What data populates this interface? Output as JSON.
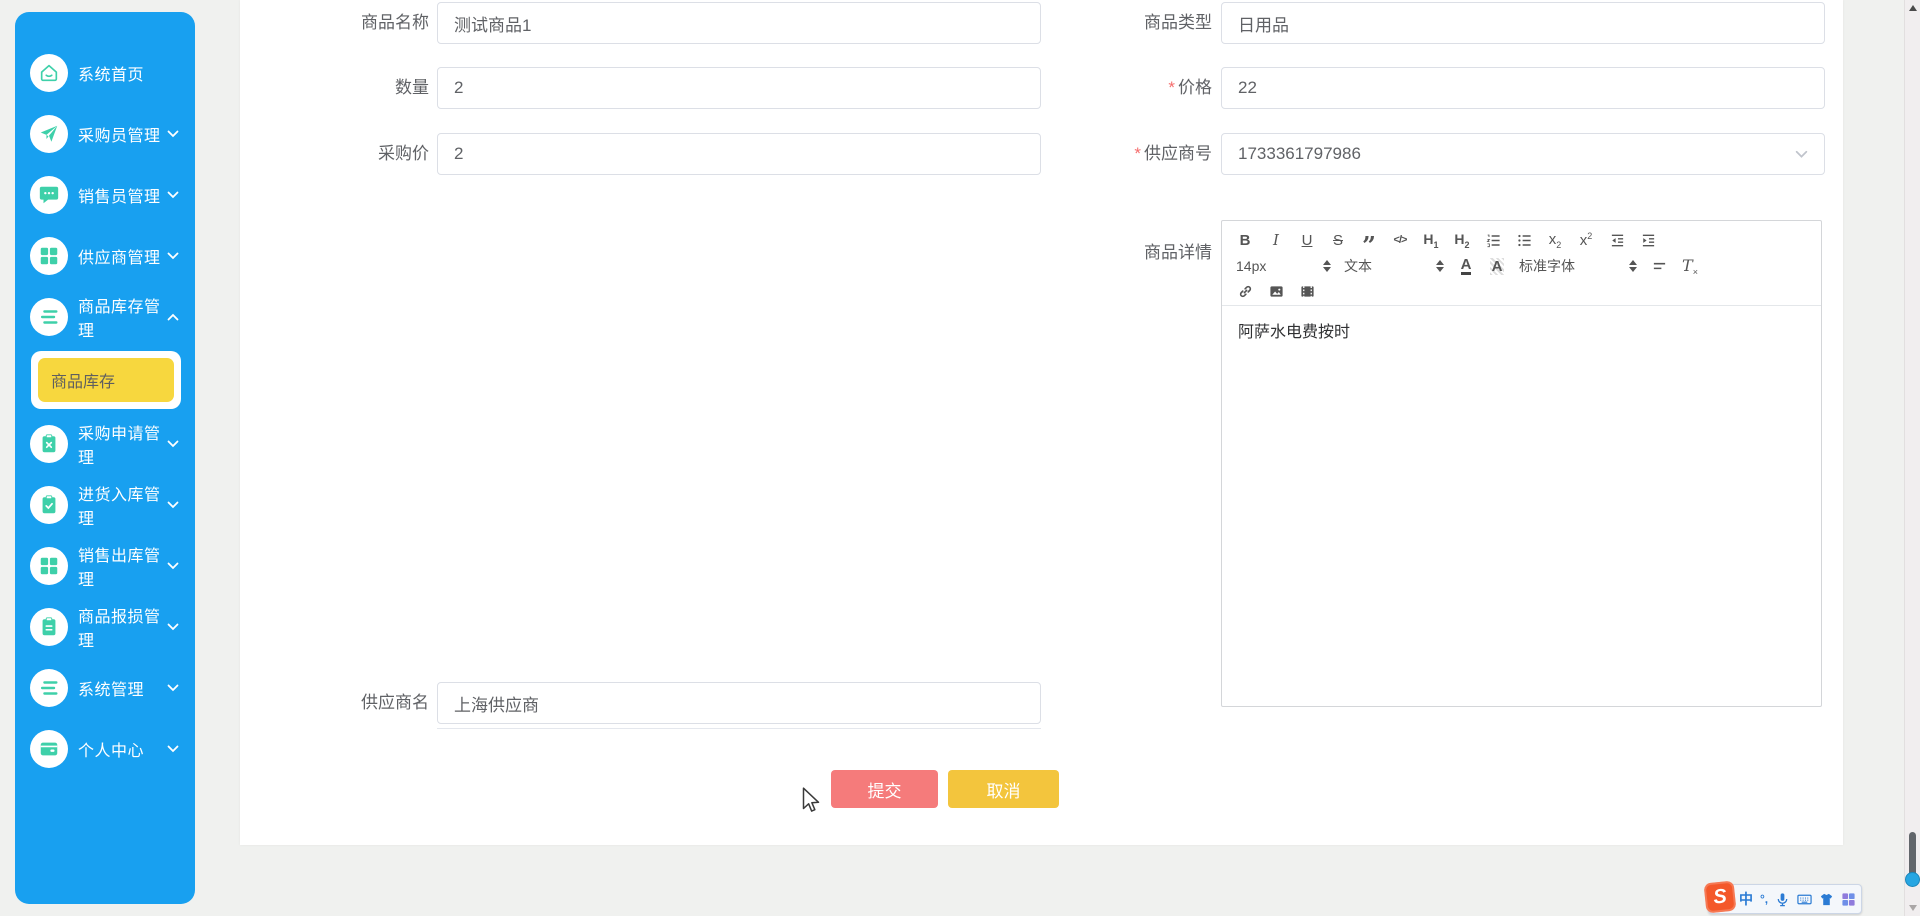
{
  "colors": {
    "sidebar_blue": "#18a0f0",
    "accent_teal": "#3ed0a9",
    "active_yellow": "#f7d73e",
    "submit_red": "#f57b7b",
    "cancel_yellow": "#f3c53d",
    "required_red": "#f56c6c"
  },
  "sidebar": {
    "items": [
      {
        "key": "home",
        "label": "系统首页",
        "icon": "home-icon",
        "chevron": null
      },
      {
        "key": "purchaser",
        "label": "采购员管理",
        "icon": "paper-plane-icon",
        "chevron": "down"
      },
      {
        "key": "salesperson",
        "label": "销售员管理",
        "icon": "chat-icon",
        "chevron": "down"
      },
      {
        "key": "supplier",
        "label": "供应商管理",
        "icon": "grid-icon",
        "chevron": "down"
      },
      {
        "key": "inventory",
        "label": "商品库存管理",
        "icon": "list-icon",
        "chevron": "up",
        "children": [
          {
            "key": "inventory-list",
            "label": "商品库存",
            "active": true
          }
        ]
      },
      {
        "key": "purchase-request",
        "label": "采购申请管理",
        "icon": "clipboard-x-icon",
        "chevron": "down"
      },
      {
        "key": "stock-in",
        "label": "进货入库管理",
        "icon": "clipboard-check-icon",
        "chevron": "down"
      },
      {
        "key": "stock-out",
        "label": "销售出库管理",
        "icon": "grid-icon",
        "chevron": "down"
      },
      {
        "key": "damage",
        "label": "商品报损管理",
        "icon": "clipboard-icon",
        "chevron": "down"
      },
      {
        "key": "system",
        "label": "系统管理",
        "icon": "list-icon",
        "chevron": "down"
      },
      {
        "key": "profile",
        "label": "个人中心",
        "icon": "wallet-icon",
        "chevron": "down"
      }
    ]
  },
  "form": {
    "required_marker": "*",
    "product_name": {
      "label": "商品名称",
      "value": "测试商品1"
    },
    "product_type": {
      "label": "商品类型",
      "value": "日用品"
    },
    "quantity": {
      "label": "数量",
      "value": "2"
    },
    "price": {
      "label": "价格",
      "value": "22",
      "required": true
    },
    "purchase_price": {
      "label": "采购价",
      "value": "2"
    },
    "supplier_no": {
      "label": "供应商号",
      "value": "1733361797986",
      "required": true
    },
    "product_detail": {
      "label": "商品详情",
      "content": "阿萨水电费按时"
    },
    "supplier_name": {
      "label": "供应商名",
      "value": "上海供应商"
    },
    "submit_label": "提交",
    "cancel_label": "取消"
  },
  "editor": {
    "toolbar": {
      "row1": [
        "bold",
        "italic",
        "underline",
        "strikethrough",
        "quote",
        "code",
        "h1",
        "h2",
        "ordered-list",
        "unordered-list",
        "subscript",
        "superscript",
        "outdent",
        "indent"
      ],
      "font_size": "14px",
      "format": "文本",
      "font_family": "标准字体",
      "row3": [
        "link",
        "image",
        "video"
      ]
    }
  },
  "ime_bar": {
    "logo": "S",
    "mode_label": "中",
    "punctuation_label": "°,"
  }
}
